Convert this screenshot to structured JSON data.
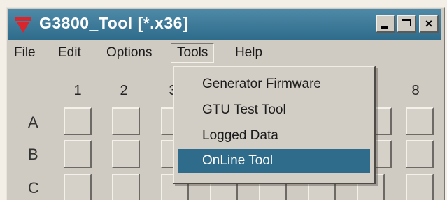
{
  "window": {
    "title": "G3800_Tool [*.x36]",
    "app_icon": "red-triangle-logo-icon",
    "buttons": {
      "minimize": "minimize-icon",
      "maximize": "maximize-icon",
      "close": "×"
    }
  },
  "menubar": {
    "items": [
      {
        "label": "File"
      },
      {
        "label": "Edit"
      },
      {
        "label": "Options"
      },
      {
        "label": "Tools",
        "open": true
      },
      {
        "label": "Help"
      }
    ]
  },
  "grid": {
    "columns": [
      "1",
      "2",
      "3",
      "8"
    ],
    "rows": [
      "A",
      "B",
      "C"
    ]
  },
  "tools_menu": {
    "items": [
      {
        "label": "Generator Firmware",
        "selected": false
      },
      {
        "label": "GTU Test Tool",
        "selected": false
      },
      {
        "label": "Logged Data",
        "selected": false
      },
      {
        "label": "OnLine Tool",
        "selected": true
      }
    ]
  },
  "colors": {
    "titlebar": "#2f6b8a",
    "selection": "#2f6b8a",
    "face": "#cfcac2",
    "logo": "#d8262c"
  }
}
